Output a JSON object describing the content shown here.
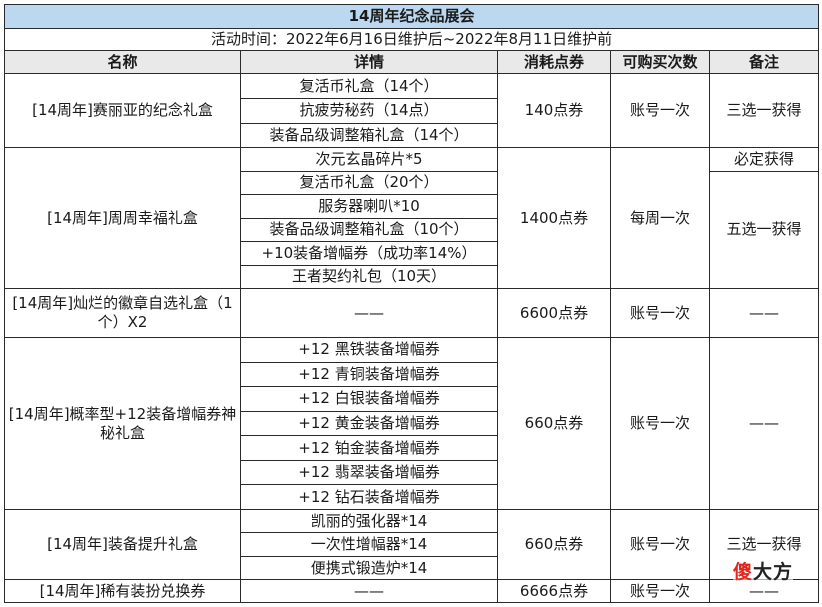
{
  "title": "14周年纪念品展会",
  "subtitle": "活动时间：2022年6月16日维护后~2022年8月11日维护前",
  "headers": [
    "名称",
    "详情",
    "消耗点券",
    "可购买次数",
    "备注"
  ],
  "items": [
    {
      "name": "[14周年]赛丽亚的纪念礼盒",
      "details": [
        "复活币礼盒（14个）",
        "抗疲劳秘药（14点）",
        "装备品级调整箱礼盒（14个）"
      ],
      "cost": "140点券",
      "limit": "账号一次",
      "note": "三选一获得"
    },
    {
      "name": "[14周年]周周幸福礼盒",
      "details": [
        "次元玄晶碎片*5",
        "复活币礼盒（20个）",
        "服务器喇叭*10",
        "装备品级调整箱礼盒（10个）",
        "+10装备增幅券（成功率14%）",
        "王者契约礼包（10天）"
      ],
      "cost": "1400点券",
      "limit": "每周一次",
      "note_first": "必定获得",
      "note": "五选一获得"
    },
    {
      "name": "[14周年]灿烂的徽章自选礼盒（1个）X2",
      "details": [
        "——"
      ],
      "cost": "6600点券",
      "limit": "账号一次",
      "note": "——"
    },
    {
      "name": "[14周年]概率型+12装备增幅券神秘礼盒",
      "details": [
        "+12 黑铁装备增幅券",
        "+12 青铜装备增幅券",
        "+12 白银装备增幅券",
        "+12 黄金装备增幅券",
        "+12 铂金装备增幅券",
        "+12 翡翠装备增幅券",
        "+12 钻石装备增幅券"
      ],
      "cost": "660点券",
      "limit": "账号一次",
      "note": "——"
    },
    {
      "name": "[14周年]装备提升礼盒",
      "details": [
        "凯丽的强化器*14",
        "一次性增幅器*14",
        "便携式锻造炉*14"
      ],
      "cost": "660点券",
      "limit": "账号一次",
      "note": "三选一获得"
    },
    {
      "name": "[14周年]稀有装扮兑换券",
      "details": [
        "——"
      ],
      "cost": "6666点券",
      "limit": "账号一次",
      "note": "——"
    }
  ],
  "watermark": {
    "part1": "傻",
    "part2": "大方"
  }
}
